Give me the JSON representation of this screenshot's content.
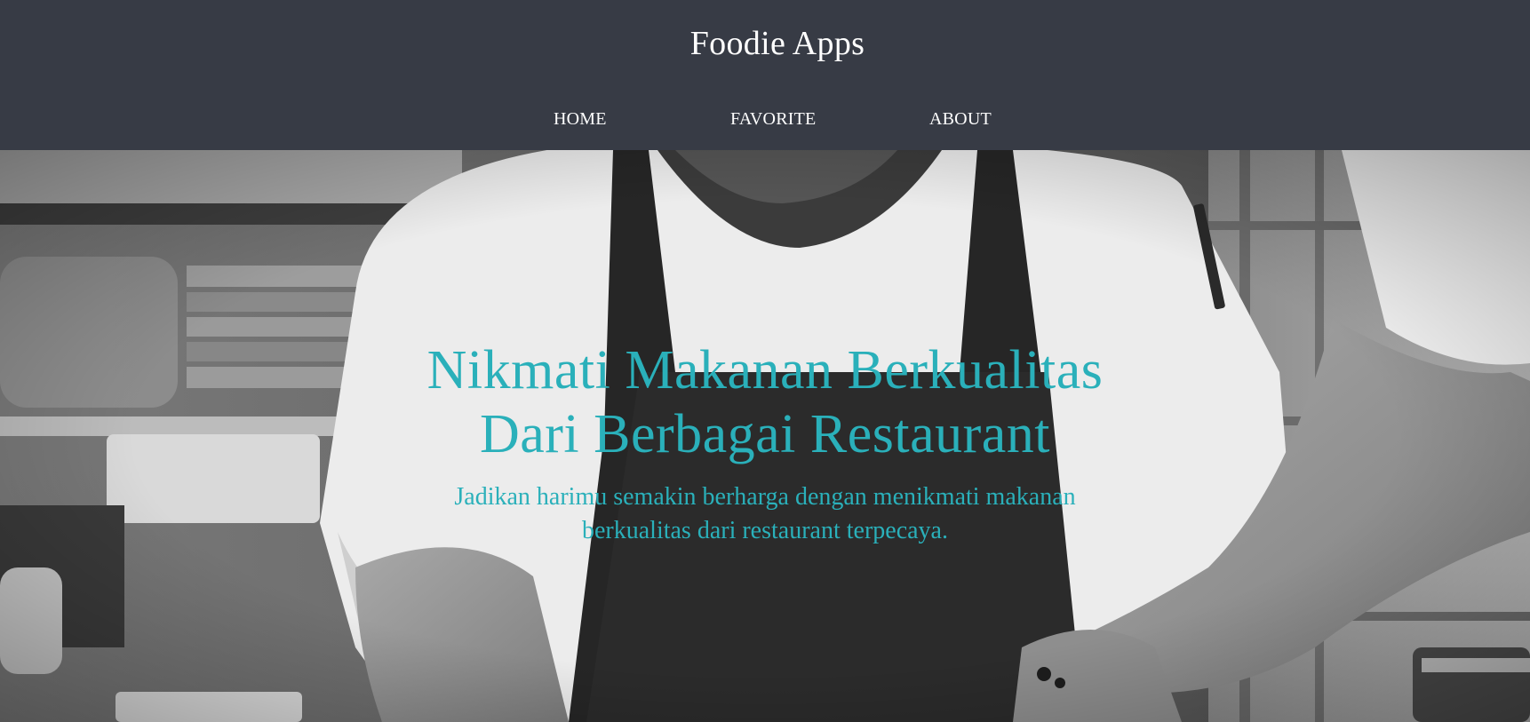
{
  "header": {
    "brand": "Foodie Apps",
    "nav": [
      {
        "label": "HOME"
      },
      {
        "label": "FAVORITE"
      },
      {
        "label": "ABOUT"
      }
    ],
    "background_color": "#373b45"
  },
  "hero": {
    "title_line1": "Nikmati Makanan Berkualitas",
    "title_line2": "Dari Berbagai Restaurant",
    "subtitle_line1": "Jadikan harimu semakin berharga dengan menikmati makanan",
    "subtitle_line2": "berkualitas dari restaurant terpecaya.",
    "accent_color": "#2ab0ba",
    "image": "chef-kitchen-photo"
  }
}
